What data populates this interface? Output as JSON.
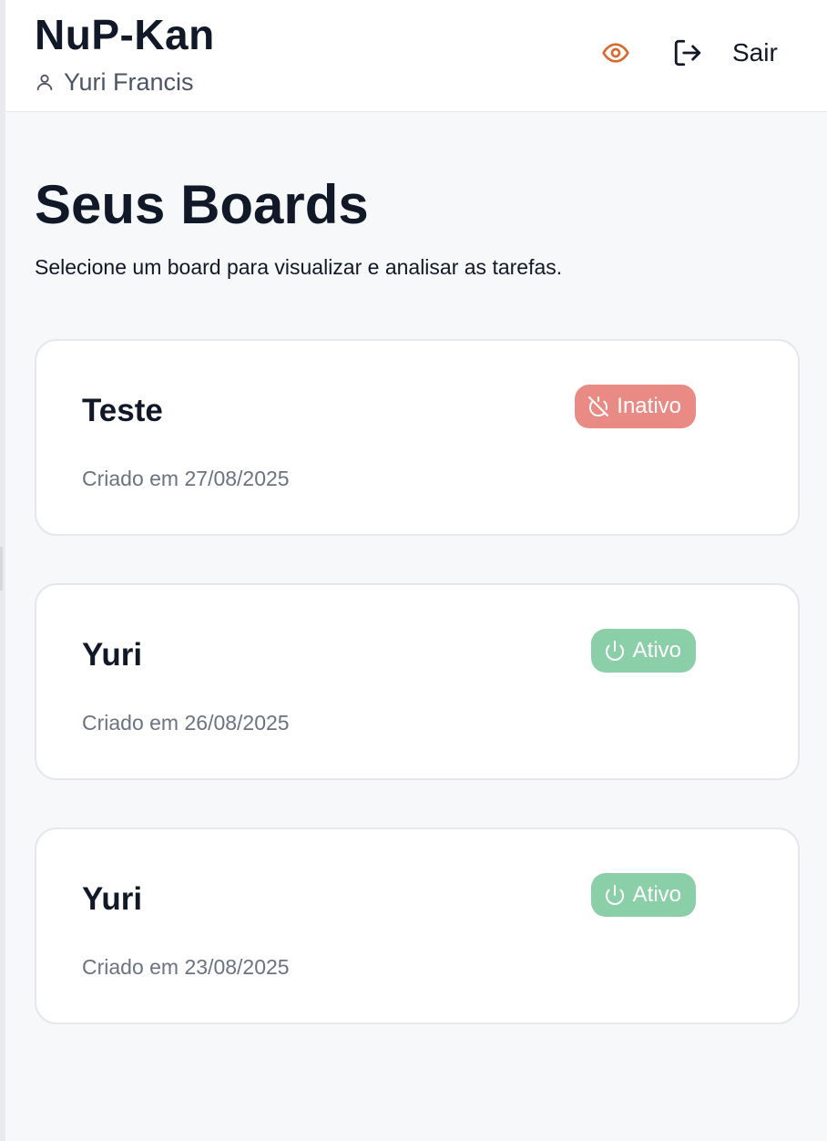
{
  "header": {
    "app_title": "NuP-Kan",
    "user_name": "Yuri Francis",
    "logout_label": "Sair"
  },
  "main": {
    "title": "Seus Boards",
    "subtitle": "Selecione um board para visualizar e analisar as tarefas."
  },
  "boards": [
    {
      "name": "Teste",
      "created": "Criado em 27/08/2025",
      "status": "Inativo"
    },
    {
      "name": "Yuri",
      "created": "Criado em 26/08/2025",
      "status": "Ativo"
    },
    {
      "name": "Yuri",
      "created": "Criado em 23/08/2025",
      "status": "Ativo"
    }
  ],
  "icons": {
    "user": "user-icon",
    "view": "eye-icon",
    "logout": "log-out-icon",
    "inactive": "power-off-icon",
    "active": "power-icon"
  },
  "colors": {
    "eye_icon": "#d9692f",
    "inactive_badge": "#e98a85",
    "active_badge": "#8bcfa8"
  }
}
